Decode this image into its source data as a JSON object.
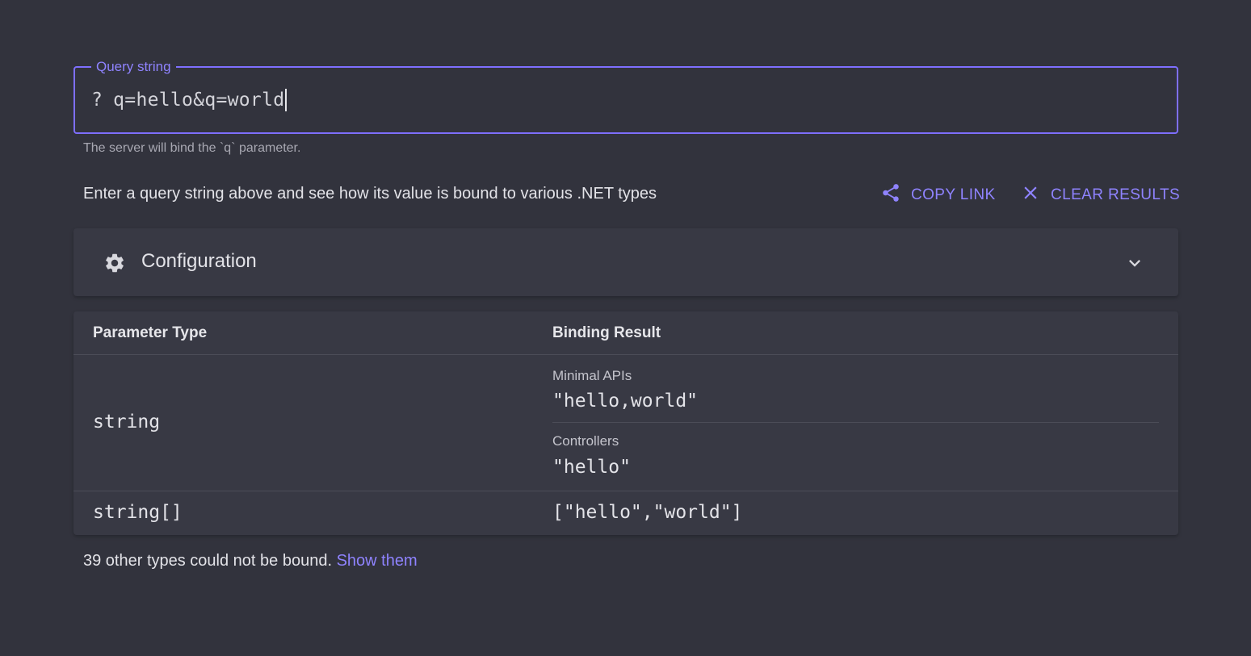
{
  "query": {
    "legend": "Query string",
    "prefix": "?",
    "value": "q=hello&q=world",
    "helper": "The server will bind the `q` parameter."
  },
  "description": "Enter a query string above and see how its value is bound to various .NET types",
  "actions": {
    "copy_link": "COPY LINK",
    "clear_results": "CLEAR RESULTS"
  },
  "config": {
    "title": "Configuration"
  },
  "table": {
    "headers": {
      "param_type": "Parameter Type",
      "binding_result": "Binding Result"
    },
    "rows": [
      {
        "type": "string",
        "results": [
          {
            "label": "Minimal APIs",
            "value": "\"hello,world\""
          },
          {
            "label": "Controllers",
            "value": "\"hello\""
          }
        ]
      },
      {
        "type": "string[]",
        "value": "[\"hello\",\"world\"]"
      }
    ]
  },
  "footer": {
    "text": "39 other types could not be bound.",
    "link": "Show them"
  },
  "colors": {
    "background": "#32333d",
    "accent": "#7e6fff",
    "panel": "#383944"
  }
}
